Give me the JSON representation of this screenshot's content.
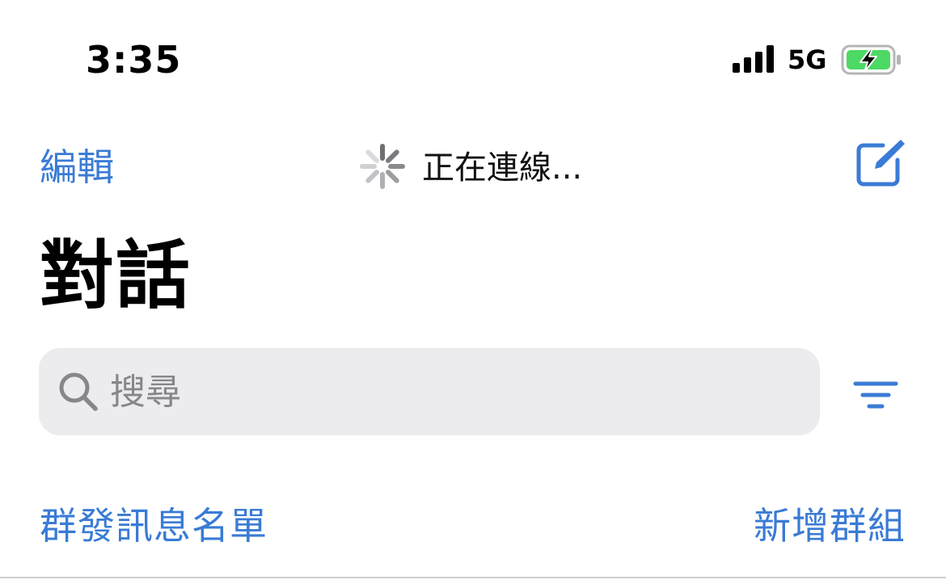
{
  "status_bar": {
    "time": "3:35",
    "network": "5G",
    "battery_charging": true,
    "battery_color": "#4cd964"
  },
  "nav": {
    "edit_label": "編輯",
    "status_text": "正在連線...",
    "compose_icon": "compose-icon",
    "accent_color": "#3a7bd5"
  },
  "title": "對話",
  "search": {
    "placeholder": "搜尋",
    "value": ""
  },
  "links": {
    "broadcast_lists": "群發訊息名單",
    "new_group": "新增群組"
  }
}
